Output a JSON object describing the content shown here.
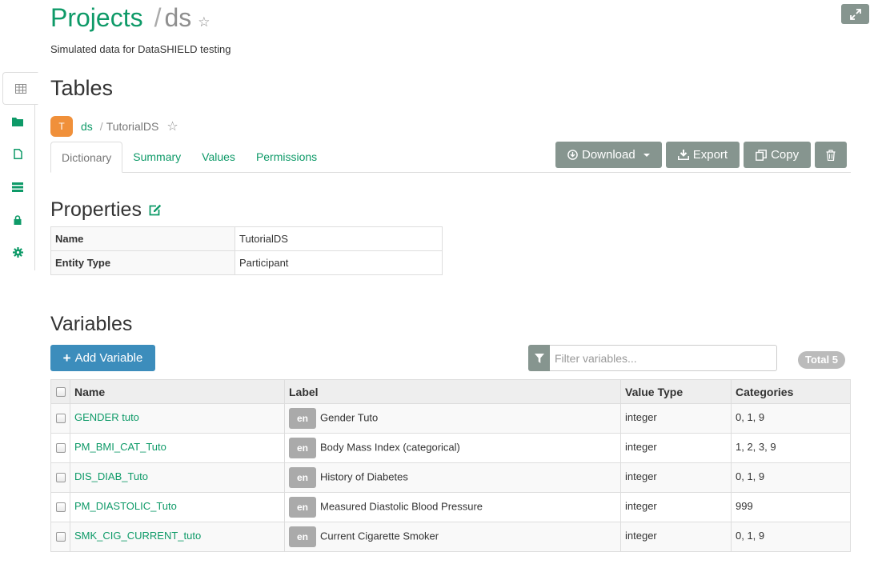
{
  "header": {
    "projects_label": "Projects",
    "separator": "/",
    "project_name": "ds",
    "star": "☆",
    "description": "Simulated data for DataSHIELD testing"
  },
  "sidebar": {
    "items": [
      {
        "icon": "table-icon",
        "active": true
      },
      {
        "icon": "folder-icon",
        "active": false
      },
      {
        "icon": "file-icon",
        "active": false
      },
      {
        "icon": "server-icon",
        "active": false
      },
      {
        "icon": "lock-icon",
        "active": false
      },
      {
        "icon": "gear-icon",
        "active": false
      }
    ]
  },
  "page": {
    "title": "Tables",
    "badge_letter": "T",
    "breadcrumb_project": "ds",
    "breadcrumb_sep": "/",
    "breadcrumb_table": "TutorialDS",
    "star": "☆"
  },
  "tabs": [
    {
      "label": "Dictionary",
      "active": true
    },
    {
      "label": "Summary",
      "active": false
    },
    {
      "label": "Values",
      "active": false
    },
    {
      "label": "Permissions",
      "active": false
    }
  ],
  "toolbar": {
    "download_label": "Download",
    "export_label": "Export",
    "copy_label": "Copy"
  },
  "properties": {
    "title": "Properties",
    "rows": [
      {
        "key": "Name",
        "value": "TutorialDS"
      },
      {
        "key": "Entity Type",
        "value": "Participant"
      }
    ]
  },
  "variables": {
    "title": "Variables",
    "add_label": "Add Variable",
    "filter_placeholder": "Filter variables...",
    "total_label": "Total 5",
    "columns": [
      "Name",
      "Label",
      "Value Type",
      "Categories"
    ],
    "rows": [
      {
        "name": "GENDER tuto",
        "lang": "en",
        "label": "Gender Tuto",
        "type": "integer",
        "categories": "0, 1, 9"
      },
      {
        "name": "PM_BMI_CAT_Tuto",
        "lang": "en",
        "label": "Body Mass Index (categorical)",
        "type": "integer",
        "categories": "1, 2, 3, 9"
      },
      {
        "name": "DIS_DIAB_Tuto",
        "lang": "en",
        "label": "History of Diabetes",
        "type": "integer",
        "categories": "0, 1, 9"
      },
      {
        "name": "PM_DIASTOLIC_Tuto",
        "lang": "en",
        "label": "Measured Diastolic Blood Pressure",
        "type": "integer",
        "categories": "999"
      },
      {
        "name": "SMK_CIG_CURRENT_tuto",
        "lang": "en",
        "label": "Current Cigarette Smoker",
        "type": "integer",
        "categories": "0, 1, 9"
      }
    ]
  },
  "colors": {
    "link_green": "#0e9a68",
    "button_gray": "#86958f",
    "primary_blue": "#3c8dbc",
    "badge_orange": "#f0903a"
  }
}
